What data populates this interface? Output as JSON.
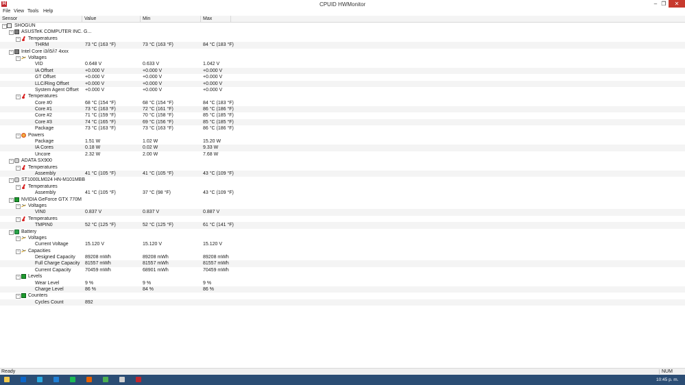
{
  "window": {
    "title": "CPUID HWMonitor",
    "app_icon_letter": "H"
  },
  "menu": [
    "File",
    "View",
    "Tools",
    "Help"
  ],
  "columns": [
    "Sensor",
    "Value",
    "Min",
    "Max"
  ],
  "rows": [
    {
      "level": 0,
      "toggle": "−",
      "icon": "monitor",
      "label": "SHOGUN"
    },
    {
      "level": 1,
      "toggle": "−",
      "icon": "chip",
      "label": "ASUSTeK COMPUTER INC. G..."
    },
    {
      "level": 2,
      "toggle": "−",
      "icon": "temp",
      "label": "Temperatures"
    },
    {
      "level": 3,
      "label": "THRM",
      "value": "73 °C  (163 °F)",
      "min": "73 °C  (163 °F)",
      "max": "84 °C  (183 °F)"
    },
    {
      "level": 1,
      "toggle": "−",
      "icon": "chip",
      "label": "Intel Core i3/i5/i7 4xxx"
    },
    {
      "level": 2,
      "toggle": "−",
      "icon": "volt",
      "label": "Voltages"
    },
    {
      "level": 3,
      "label": "VID",
      "value": "0.648 V",
      "min": "0.633 V",
      "max": "1.042 V"
    },
    {
      "level": 3,
      "label": "IA Offset",
      "value": "+0.000 V",
      "min": "+0.000 V",
      "max": "+0.000 V"
    },
    {
      "level": 3,
      "label": "GT Offset",
      "value": "+0.000 V",
      "min": "+0.000 V",
      "max": "+0.000 V"
    },
    {
      "level": 3,
      "label": "LLC/Ring Offset",
      "value": "+0.000 V",
      "min": "+0.000 V",
      "max": "+0.000 V"
    },
    {
      "level": 3,
      "label": "System Agent Offset",
      "value": "+0.000 V",
      "min": "+0.000 V",
      "max": "+0.000 V"
    },
    {
      "level": 2,
      "toggle": "−",
      "icon": "temp",
      "label": "Temperatures"
    },
    {
      "level": 3,
      "label": "Core #0",
      "value": "68 °C  (154 °F)",
      "min": "68 °C  (154 °F)",
      "max": "84 °C  (183 °F)"
    },
    {
      "level": 3,
      "label": "Core #1",
      "value": "73 °C  (163 °F)",
      "min": "72 °C  (161 °F)",
      "max": "86 °C  (186 °F)"
    },
    {
      "level": 3,
      "label": "Core #2",
      "value": "71 °C  (159 °F)",
      "min": "70 °C  (158 °F)",
      "max": "85 °C  (185 °F)"
    },
    {
      "level": 3,
      "label": "Core #3",
      "value": "74 °C  (165 °F)",
      "min": "69 °C  (156 °F)",
      "max": "85 °C  (185 °F)"
    },
    {
      "level": 3,
      "label": "Package",
      "value": "73 °C  (163 °F)",
      "min": "73 °C  (163 °F)",
      "max": "86 °C  (186 °F)"
    },
    {
      "level": 2,
      "toggle": "−",
      "icon": "power",
      "label": "Powers"
    },
    {
      "level": 3,
      "label": "Package",
      "value": "1.51 W",
      "min": "1.02 W",
      "max": "15.20 W"
    },
    {
      "level": 3,
      "label": "IA Cores",
      "value": "0.18 W",
      "min": "0.02 W",
      "max": "9.33 W"
    },
    {
      "level": 3,
      "label": "Uncore",
      "value": "2.32 W",
      "min": "2.00 W",
      "max": "7.68 W"
    },
    {
      "level": 1,
      "toggle": "−",
      "icon": "disk",
      "label": "ADATA SX900"
    },
    {
      "level": 2,
      "toggle": "−",
      "icon": "temp",
      "label": "Temperatures"
    },
    {
      "level": 3,
      "label": "Assembly",
      "value": "41 °C  (105 °F)",
      "min": "41 °C  (105 °F)",
      "max": "43 °C  (109 °F)"
    },
    {
      "level": 1,
      "toggle": "−",
      "icon": "disk",
      "label": "ST1000LM024 HN-M101MBB"
    },
    {
      "level": 2,
      "toggle": "−",
      "icon": "temp",
      "label": "Temperatures"
    },
    {
      "level": 3,
      "label": "Assembly",
      "value": "41 °C  (105 °F)",
      "min": "37 °C  (98 °F)",
      "max": "43 °C  (109 °F)"
    },
    {
      "level": 1,
      "toggle": "−",
      "icon": "green",
      "label": "NVIDIA GeForce GTX 770M"
    },
    {
      "level": 2,
      "toggle": "−",
      "icon": "volt",
      "label": "Voltages"
    },
    {
      "level": 3,
      "label": "VIN0",
      "value": "0.837 V",
      "min": "0.837 V",
      "max": "0.887 V"
    },
    {
      "level": 2,
      "toggle": "−",
      "icon": "temp",
      "label": "Temperatures"
    },
    {
      "level": 3,
      "label": "TMPIN0",
      "value": "52 °C  (125 °F)",
      "min": "52 °C  (125 °F)",
      "max": "61 °C  (141 °F)"
    },
    {
      "level": 1,
      "toggle": "−",
      "icon": "battery",
      "label": "Battery"
    },
    {
      "level": 2,
      "toggle": "−",
      "icon": "volt",
      "label": "Voltages"
    },
    {
      "level": 3,
      "label": "Current Voltage",
      "value": "15.120 V",
      "min": "15.120 V",
      "max": "15.120 V"
    },
    {
      "level": 2,
      "toggle": "−",
      "icon": "volt",
      "label": "Capacities"
    },
    {
      "level": 3,
      "label": "Designed Capacity",
      "value": "89208 mWh",
      "min": "89208 mWh",
      "max": "89208 mWh"
    },
    {
      "level": 3,
      "label": "Full Charge Capacity",
      "value": "81557 mWh",
      "min": "81557 mWh",
      "max": "81557 mWh"
    },
    {
      "level": 3,
      "label": "Current Capacity",
      "value": "70459 mWh",
      "min": "68901 mWh",
      "max": "70459 mWh"
    },
    {
      "level": 2,
      "toggle": "−",
      "icon": "green",
      "label": "Levels"
    },
    {
      "level": 3,
      "label": "Wear Level",
      "value": "9 %",
      "min": "9 %",
      "max": "9 %"
    },
    {
      "level": 3,
      "label": "Charge Level",
      "value": "86 %",
      "min": "84 %",
      "max": "86 %"
    },
    {
      "level": 2,
      "toggle": "−",
      "icon": "green",
      "label": "Counters"
    },
    {
      "level": 3,
      "label": "Cycles Count",
      "value": "892",
      "min": "",
      "max": ""
    }
  ],
  "status": {
    "left": "Ready",
    "num": "NUM"
  },
  "taskbar": {
    "clock": "10:45 p. m.",
    "icons": [
      {
        "name": "file-explorer-icon",
        "color": "#f2c94c"
      },
      {
        "name": "outlook-icon",
        "color": "#0a64c8"
      },
      {
        "name": "skype-icon",
        "color": "#2aa9e0"
      },
      {
        "name": "ie-icon",
        "color": "#1f7fd6"
      },
      {
        "name": "spotify-icon",
        "color": "#1db954"
      },
      {
        "name": "firefox-icon",
        "color": "#e66000"
      },
      {
        "name": "chrome-icon",
        "color": "#4caf50"
      },
      {
        "name": "steam-icon",
        "color": "#d0d0d0"
      },
      {
        "name": "hwmonitor-taskbar-icon",
        "color": "#c1272d"
      }
    ]
  }
}
